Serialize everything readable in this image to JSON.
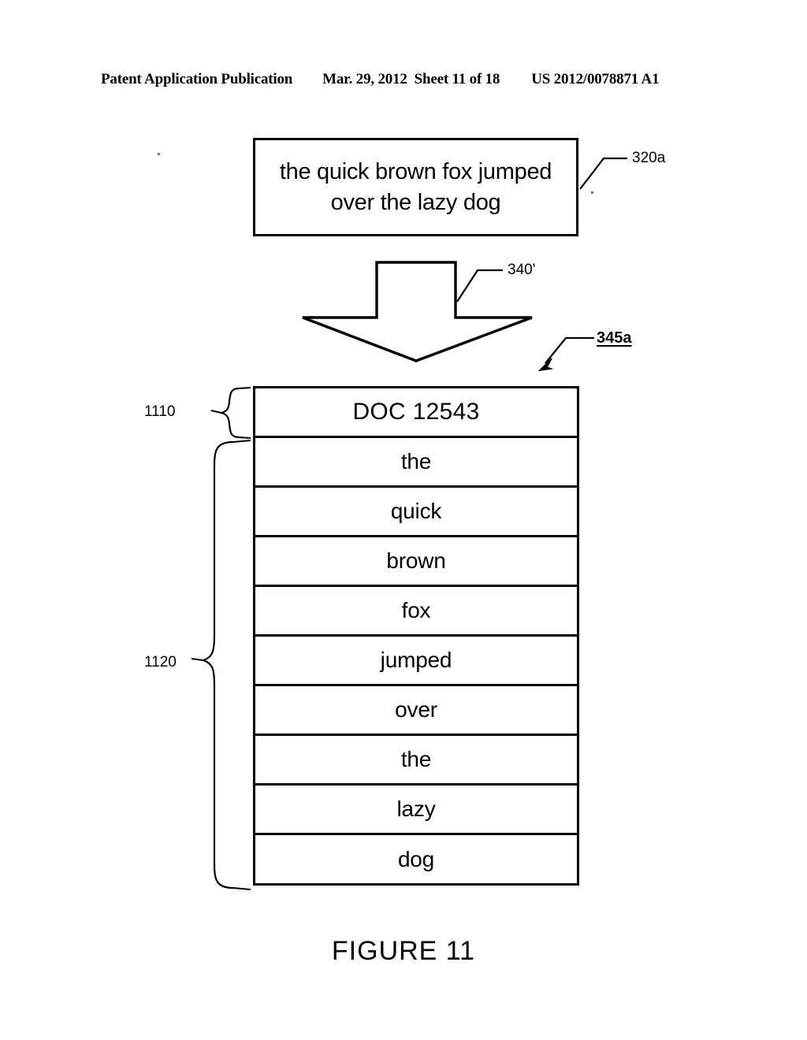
{
  "header": {
    "publication": "Patent Application Publication",
    "date": "Mar. 29, 2012",
    "sheet": "Sheet 11 of 18",
    "pub_number": "US 2012/0078871 A1"
  },
  "figure": {
    "caption": "FIGURE 11",
    "source_box": {
      "line1": "the quick brown fox jumped",
      "line2": "over the lazy dog",
      "ref": "320a"
    },
    "transform_arrow": {
      "ref": "340'"
    },
    "record": {
      "ref": "345a",
      "header_brace_ref": "1110",
      "body_brace_ref": "1120",
      "header_row": "DOC 12543",
      "rows": [
        "the",
        "quick",
        "brown",
        "fox",
        "jumped",
        "over",
        "the",
        "lazy",
        "dog"
      ]
    }
  },
  "colors": {
    "ink": "#000000",
    "paper": "#ffffff"
  }
}
